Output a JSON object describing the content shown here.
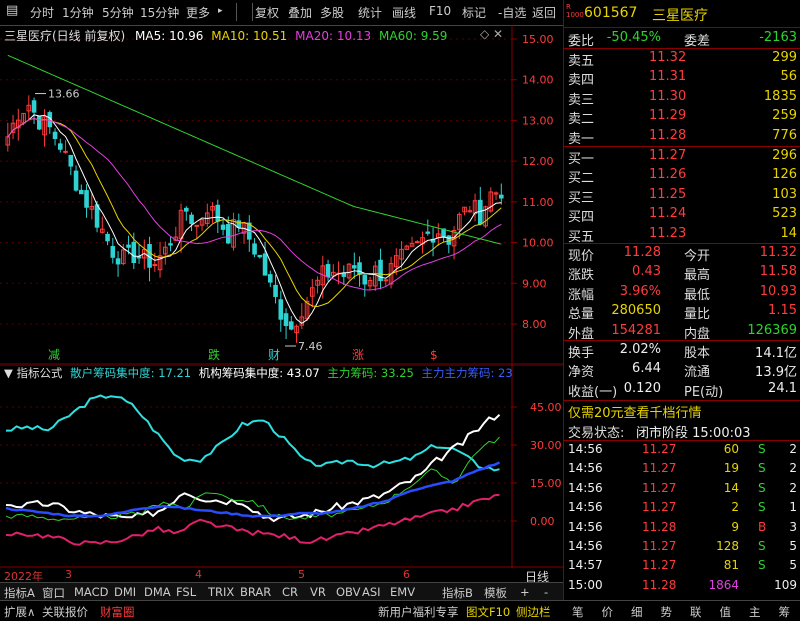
{
  "toolbar": {
    "items": [
      "分时",
      "1分钟",
      "5分钟",
      "15分钟",
      "更多",
      "复权",
      "叠加",
      "多股",
      "统计",
      "画线",
      "F10",
      "标记",
      "-自选",
      "返回"
    ]
  },
  "main_chart": {
    "title": "三星医疗(日线 前复权)",
    "ma_labels": [
      "MA5: 10.96",
      "MA10: 10.51",
      "MA20: 10.13",
      "MA60: 9.59"
    ],
    "high_label": "13.66",
    "low_label": "7.46",
    "y_ticks": [
      "15.00",
      "14.00",
      "13.00",
      "12.00",
      "11.00",
      "10.00",
      "9.00",
      "8.00"
    ],
    "markers": [
      "减",
      "跌",
      "财",
      "涨",
      "$"
    ]
  },
  "sub_chart": {
    "name": "指标公式",
    "labels": [
      "散户筹码集中度: 17.21",
      "机构筹码集中度: 43.07",
      "主力筹码: 33.25",
      "主力主力筹码: 23"
    ],
    "y_ticks": [
      "45.00",
      "30.00",
      "15.00",
      "0.00"
    ]
  },
  "time_axis": [
    "2022年",
    "3",
    "4",
    "5",
    "6"
  ],
  "time_axis_right": "日线",
  "bottom_bar1": [
    "指标A",
    "窗口",
    "MACD",
    "DMI",
    "DMA",
    "FSL",
    "TRIX",
    "BRAR",
    "CR",
    "VR",
    "OBV",
    "ASI",
    "EMV",
    "指标B",
    "模板",
    "+",
    "-"
  ],
  "bottom_bar2": [
    "扩展∧",
    "关联报价",
    "财富圈",
    "新用户福利专享",
    "图文F10",
    "侧边栏"
  ],
  "bottom_tabs": [
    "笔",
    "价",
    "细",
    "势",
    "联",
    "值",
    "主",
    "筹"
  ],
  "quote": {
    "code": "601567",
    "name": "三星医疗",
    "weibi_label": "委比",
    "weibi": "-50.45%",
    "weicha_label": "委差",
    "weicha": "-2163",
    "sells": [
      {
        "label": "卖五",
        "price": "11.32",
        "vol": "299"
      },
      {
        "label": "卖四",
        "price": "11.31",
        "vol": "56"
      },
      {
        "label": "卖三",
        "price": "11.30",
        "vol": "1835"
      },
      {
        "label": "卖二",
        "price": "11.29",
        "vol": "259"
      },
      {
        "label": "卖一",
        "price": "11.28",
        "vol": "776"
      }
    ],
    "buys": [
      {
        "label": "买一",
        "price": "11.27",
        "vol": "296"
      },
      {
        "label": "买二",
        "price": "11.26",
        "vol": "126"
      },
      {
        "label": "买三",
        "price": "11.25",
        "vol": "103"
      },
      {
        "label": "买四",
        "price": "11.24",
        "vol": "523"
      },
      {
        "label": "买五",
        "price": "11.23",
        "vol": "14"
      }
    ],
    "stats": [
      {
        "l1": "现价",
        "v1": "11.28",
        "c1": "red",
        "l2": "今开",
        "v2": "11.32",
        "c2": "red"
      },
      {
        "l1": "涨跌",
        "v1": "0.43",
        "c1": "red",
        "l2": "最高",
        "v2": "11.58",
        "c2": "red"
      },
      {
        "l1": "涨幅",
        "v1": "3.96%",
        "c1": "red",
        "l2": "最低",
        "v2": "10.93",
        "c2": "red"
      },
      {
        "l1": "总量",
        "v1": "280650",
        "c1": "yel",
        "l2": "量比",
        "v2": "1.15",
        "c2": "red"
      },
      {
        "l1": "外盘",
        "v1": "154281",
        "c1": "red",
        "l2": "内盘",
        "v2": "126369",
        "c2": "grn"
      }
    ],
    "stats2": [
      {
        "l1": "换手",
        "v1": "2.02%",
        "l2": "股本",
        "v2": "14.1亿"
      },
      {
        "l1": "净资",
        "v1": "6.44",
        "l2": "流通",
        "v2": "13.9亿"
      },
      {
        "l1": "收益(一)",
        "v1": "0.120",
        "l2": "PE(动)",
        "v2": "24.1"
      }
    ],
    "promo": "仅需20元查看千档行情",
    "status_label": "交易状态:",
    "status_value": "闭市阶段 15:00:03",
    "ticks": [
      {
        "t": "14:56",
        "p": "11.27",
        "v": "60",
        "d": "S",
        "n": "2"
      },
      {
        "t": "14:56",
        "p": "11.27",
        "v": "19",
        "d": "S",
        "n": "2"
      },
      {
        "t": "14:56",
        "p": "11.27",
        "v": "14",
        "d": "S",
        "n": "2"
      },
      {
        "t": "14:56",
        "p": "11.27",
        "v": "2",
        "d": "S",
        "n": "1"
      },
      {
        "t": "14:56",
        "p": "11.28",
        "v": "9",
        "d": "B",
        "n": "3"
      },
      {
        "t": "14:56",
        "p": "11.27",
        "v": "128",
        "d": "S",
        "n": "5"
      },
      {
        "t": "14:57",
        "p": "11.27",
        "v": "81",
        "d": "S",
        "n": "5"
      },
      {
        "t": "15:00",
        "p": "11.28",
        "v": "1864",
        "d": "",
        "n": "109"
      }
    ]
  },
  "colors": {
    "up": "#ff3b3b",
    "down": "#2fd2d2",
    "ma5": "#ffffff",
    "ma10": "#e8d400",
    "ma20": "#e040e0",
    "ma60": "#2fd22f"
  }
}
